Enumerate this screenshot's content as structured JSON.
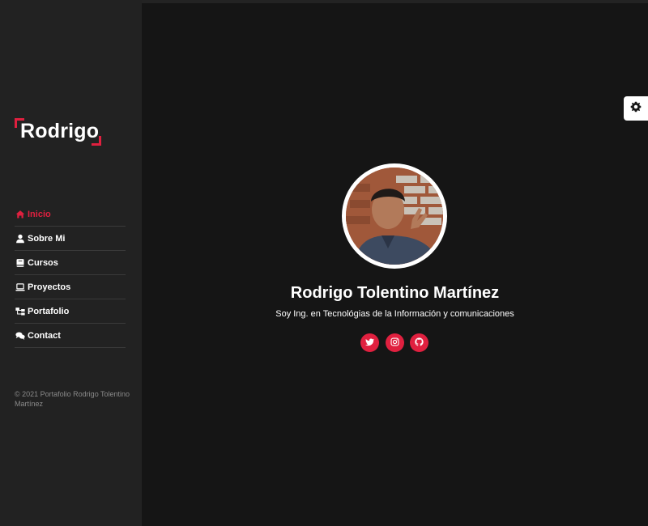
{
  "brand": {
    "name": "Rodrigo",
    "accent": "#e0203f"
  },
  "nav": {
    "items": [
      {
        "label": "Inicio",
        "icon": "home-icon",
        "active": true
      },
      {
        "label": "Sobre Mi",
        "icon": "user-icon",
        "active": false
      },
      {
        "label": "Cursos",
        "icon": "book-icon",
        "active": false
      },
      {
        "label": "Proyectos",
        "icon": "laptop-icon",
        "active": false
      },
      {
        "label": "Portafolio",
        "icon": "sitemap-icon",
        "active": false
      },
      {
        "label": "Contact",
        "icon": "comments-icon",
        "active": false
      }
    ]
  },
  "footer": {
    "text": "© 2021 Portafolio Rodrigo Tolentino Martínez"
  },
  "hero": {
    "name": "Rodrigo Tolentino Martínez",
    "subtitle": "Soy Ing. en Tecnológias de la Información y comunicaciones"
  },
  "socials": [
    {
      "icon": "twitter-icon"
    },
    {
      "icon": "instagram-icon"
    },
    {
      "icon": "github-icon"
    }
  ],
  "settings": {
    "icon": "gear-icon"
  },
  "colors": {
    "background": "#151515",
    "sidebar": "#222222",
    "accent": "#e0203f"
  }
}
